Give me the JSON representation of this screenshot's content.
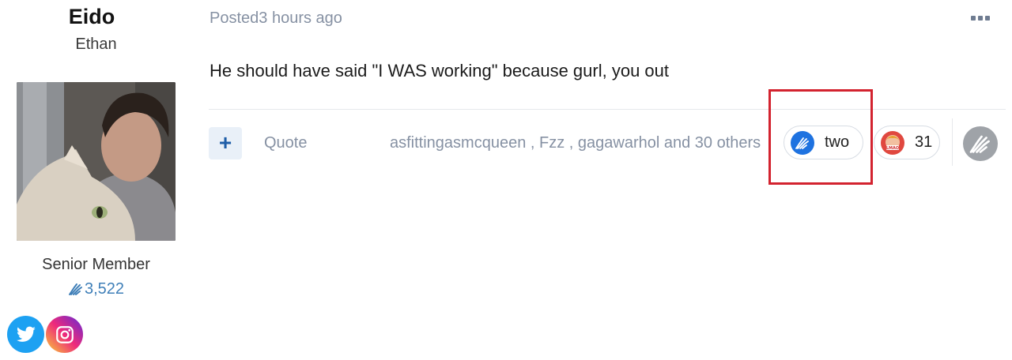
{
  "author": {
    "name": "Eido",
    "subtitle": "Ethan",
    "rank": "Senior Member",
    "reputation": "3,522",
    "avatar_icon": "user-avatar-photo",
    "social": [
      "twitter-icon",
      "instagram-icon"
    ]
  },
  "post": {
    "meta": "Posted3 hours ago",
    "body": "He should have said \"I WAS working\" because gurl, you out",
    "more_icon": "ellipsis-icon"
  },
  "actions": {
    "plus_label": "+",
    "quote_label": "Quote",
    "reactors_text": "asfittingasmcqueen , Fzz , gagawarhol and 30 others"
  },
  "reactions": [
    {
      "icon": "two-reaction-icon",
      "count": "two",
      "color": "#1e72e0"
    },
    {
      "icon": "lmao-reaction-icon",
      "count": "31",
      "color": "#e0483f"
    }
  ],
  "colors": {
    "accent": "#1f5ea8",
    "highlight": "#d3232f",
    "muted_text": "#8691a3"
  }
}
